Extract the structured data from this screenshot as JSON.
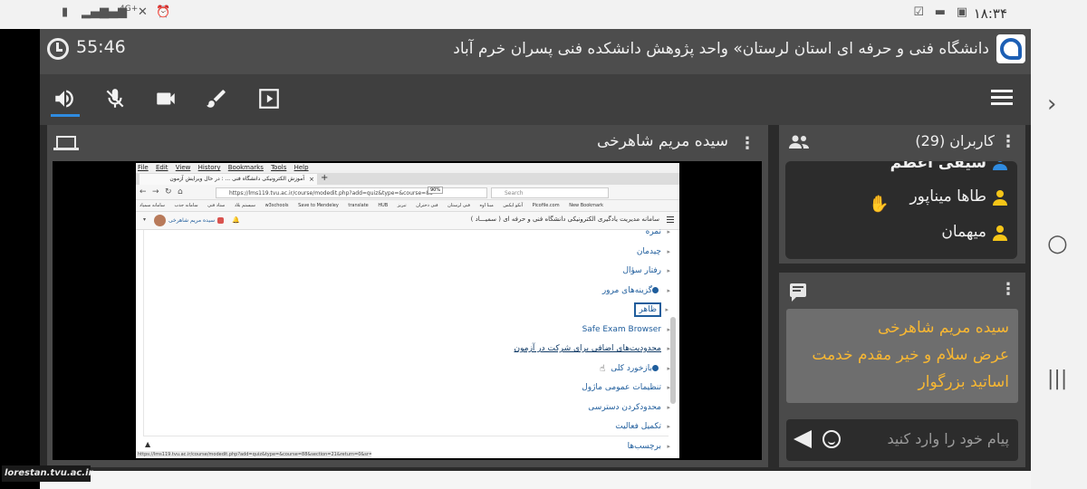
{
  "statusbar": {
    "time": "۱۸:۳۴",
    "network": "4G+"
  },
  "watermark": "lorestan.tvu.ac.ir",
  "header": {
    "timer": "55:46",
    "title": "دانشگاه فنی و حرفه ای استان لرستان» واحد پژوهش دانشکده فنی پسران خرم آباد"
  },
  "toolbar": {
    "items": [
      "speaker-icon",
      "mic-muted-icon",
      "camera-icon",
      "brush-icon",
      "play-icon",
      "menu-icon"
    ]
  },
  "presentation": {
    "presenter": "سیده مریم شاهرخی"
  },
  "shared_screen": {
    "menubar": [
      "File",
      "Edit",
      "View",
      "History",
      "Bookmarks",
      "Tools",
      "Help"
    ],
    "tab_title": "آموزش الکترونیکی دانشگاه فنی ... : در حال ویرایش آزمون",
    "url": "https://lms119.tvu.ac.ir/course/modedit.php?add=quiz&type=&course=88",
    "zoom": "90%",
    "search_placeholder": "Search",
    "bookmarks": [
      "سیستم بلاد",
      "ستاد فنی",
      "سامانه جذب",
      "سامانه سمیاد",
      "w3schools",
      "Save to Mendeley",
      "translate",
      "HUB",
      "آنکو ایکس",
      "مبنا اوه",
      "فنی لرستان",
      "فنی دختران",
      "تبریز",
      "Picofile.com",
      "New Bookmark"
    ],
    "site_name": "سامانه مدیریت یادگیری الکترونیکی دانشگاه فنی و حرفه ای ( سمیـــاد )",
    "user_name": "سیده مریم شاهرخی",
    "settings_items": [
      "نمره",
      "چیدمان",
      "رفتار سؤال",
      "گزینه‌های مرور",
      "ظاهر",
      "Safe Exam Browser",
      "محدودیت‌های اضافی برای شرکت در آزمون",
      "بازخورد کلی",
      "تنظیمات عمومی ماژول",
      "محدودکردن دسترسی",
      "تکمیل فعالیت",
      "برچسب‌ها"
    ],
    "status_url": "https://lms119.tvu.ac.ir/course/modedit.php?add=quiz&type=&course=88&section=21&return=0&sr=0#"
  },
  "users": {
    "title": "کاربران (29)",
    "list": [
      {
        "name": "سیفی اعظم"
      },
      {
        "name": "طاها میناپور"
      },
      {
        "name": "میهمان"
      }
    ]
  },
  "chat": {
    "sender": "سیده مریم شاهرخی",
    "message": "عرض سلام و خیر مقدم خدمت اساتید بزرگوار",
    "input_placeholder": "پیام خود را وارد کنید"
  },
  "colors": {
    "accent": "#2f8be0",
    "chat_text": "#f7b733",
    "user_icon": "#f5c518"
  }
}
